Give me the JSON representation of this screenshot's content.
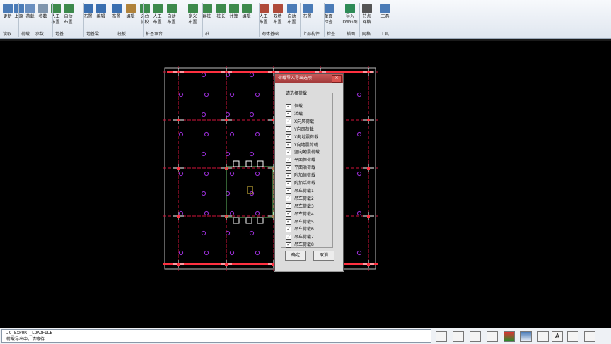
{
  "ribbon": {
    "buttons": [
      {
        "label": "更新",
        "icon": "refresh-icon",
        "color": "#4a7bb7"
      },
      {
        "label": "上源",
        "icon": "upload-icon",
        "color": "#4a7bb7"
      },
      {
        "label": "荷载",
        "icon": "load-icon",
        "color": "#6a8fbf"
      },
      {
        "label": "参数",
        "icon": "settings-icon",
        "color": "#7f95ad"
      },
      {
        "label": "人工布置",
        "icon": "manual-place-icon",
        "color": "#3d8a4c"
      },
      {
        "label": "自动布置",
        "icon": "auto-place-icon",
        "color": "#3d8a4c"
      },
      {
        "label": "布置",
        "icon": "beam-place-icon",
        "color": "#3a6fb0"
      },
      {
        "label": "编辑",
        "icon": "beam-edit-icon",
        "color": "#3a6fb0"
      },
      {
        "label": "布置",
        "icon": "place-icon",
        "color": "#3a6fb0"
      },
      {
        "label": "编辑",
        "icon": "edit-icon",
        "color": "#b0823a"
      },
      {
        "label": "选台前校",
        "icon": "pile-icon",
        "color": "#3d8a4c"
      },
      {
        "label": "人工布置",
        "icon": "manual-icon",
        "color": "#3d8a4c"
      },
      {
        "label": "自动布置",
        "icon": "auto-icon",
        "color": "#3d8a4c"
      },
      {
        "label": "定义布置",
        "icon": "define-icon",
        "color": "#3d8a4c"
      },
      {
        "label": "群桩",
        "icon": "pile-group-icon",
        "color": "#3d8a4c"
      },
      {
        "label": "桩长",
        "icon": "pile-length-icon",
        "color": "#3d8a4c"
      },
      {
        "label": "计算",
        "icon": "calc-icon",
        "color": "#3d8a4c"
      },
      {
        "label": "编辑",
        "icon": "grid-edit-icon",
        "color": "#3d8a4c"
      },
      {
        "label": "人工布置",
        "icon": "wall-manual-icon",
        "color": "#b04a3a"
      },
      {
        "label": "双墙布置",
        "icon": "wall-double-icon",
        "color": "#b04a3a"
      },
      {
        "label": "自动布置",
        "icon": "upper-auto-icon",
        "color": "#4a7bb7"
      },
      {
        "label": "布置",
        "icon": "upper-place-icon",
        "color": "#4a7bb7"
      },
      {
        "label": "单面检查",
        "icon": "check-icon",
        "color": "#4a7bb7"
      },
      {
        "label": "导入DWG图",
        "icon": "import-dwg-icon",
        "color": "#2e8b57"
      },
      {
        "label": "节点网格",
        "icon": "node-grid-icon",
        "color": "#555555"
      },
      {
        "label": "工具",
        "icon": "tools-icon",
        "color": "#4a7bb7"
      }
    ],
    "groups": [
      "读取",
      "荷载",
      "参数",
      "地基",
      "地基梁",
      "筏板",
      "桩基承台",
      "桩",
      "砌体基础",
      "上部构件",
      "检查",
      "插图",
      "网格",
      "工具"
    ]
  },
  "dialog": {
    "title": "荷载导入导出选项",
    "close": "×",
    "fieldset_label": "请选择荷载",
    "items": [
      {
        "label": "恒载",
        "checked": "☑"
      },
      {
        "label": "活载",
        "checked": "☑"
      },
      {
        "label": "X向风荷载",
        "checked": "☑"
      },
      {
        "label": "Y向风荷载",
        "checked": "☑"
      },
      {
        "label": "X向地震荷载",
        "checked": "☑"
      },
      {
        "label": "Y向地震荷载",
        "checked": "☑"
      },
      {
        "label": "竖向地震荷载",
        "checked": "☑"
      },
      {
        "label": "平面恒荷载",
        "checked": "☑"
      },
      {
        "label": "平面活荷载",
        "checked": "☑"
      },
      {
        "label": "附加恒荷载",
        "checked": "☑"
      },
      {
        "label": "附加活荷载",
        "checked": "☑"
      },
      {
        "label": "吊车荷载1",
        "checked": "☑"
      },
      {
        "label": "吊车荷载2",
        "checked": "☑"
      },
      {
        "label": "吊车荷载3",
        "checked": "☑"
      },
      {
        "label": "吊车荷载4",
        "checked": "☑"
      },
      {
        "label": "吊车荷载5",
        "checked": "☑"
      },
      {
        "label": "吊车荷载6",
        "checked": "☑"
      },
      {
        "label": "吊车荷载7",
        "checked": "☑"
      },
      {
        "label": "吊车荷载8",
        "checked": "☑"
      }
    ],
    "ok": "确定",
    "cancel": "取消"
  },
  "command": {
    "line1": "JC_EXPORT_LOADFILE",
    "line2": "荷载导出中，请等待..."
  },
  "statusbar": {
    "icons": [
      "view-icon",
      "box-icon",
      "cube-icon",
      "layer-icon",
      "export-icon",
      "table-icon",
      "save-icon",
      "text-size-icon",
      "fit-icon",
      "grid-icon"
    ],
    "text_size_label": "A"
  },
  "colors": {
    "grid": "#d4143c",
    "marker": "#9a2fd8",
    "highlight": "#ffffff",
    "outline": "#66c266"
  }
}
